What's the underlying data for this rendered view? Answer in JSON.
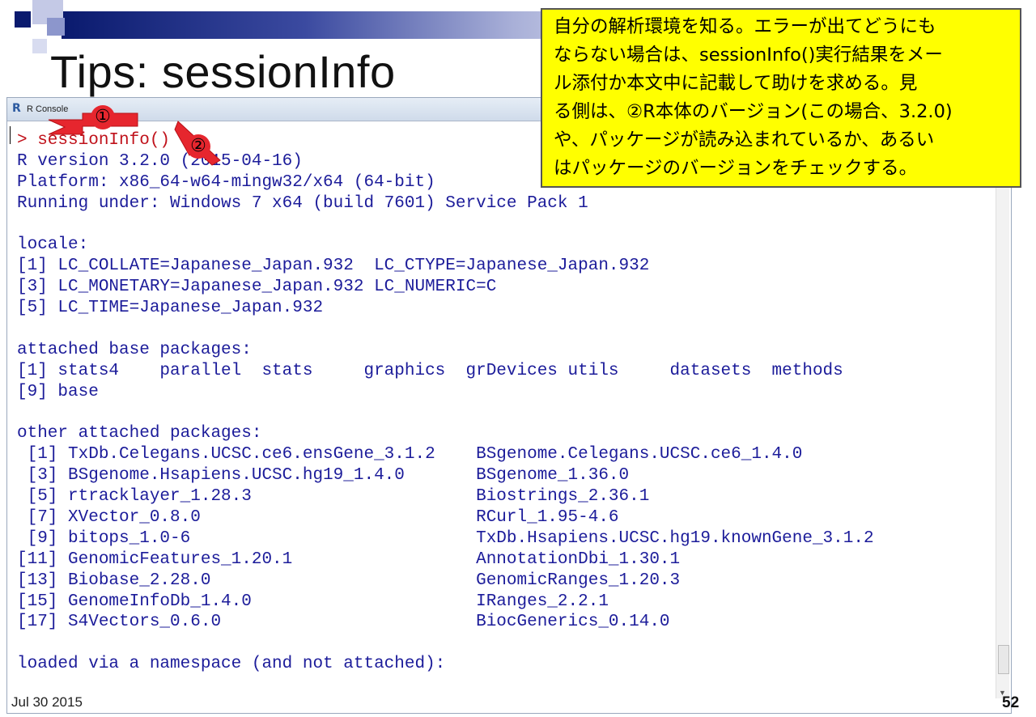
{
  "slide": {
    "title": "Tips: sessionInfo",
    "footer_date": "Jul 30 2015",
    "page_number": "52"
  },
  "console": {
    "window_title": "R Console",
    "lines": [
      "> sessionInfo()",
      "R version 3.2.0 (2015-04-16)",
      "Platform: x86_64-w64-mingw32/x64 (64-bit)",
      "Running under: Windows 7 x64 (build 7601) Service Pack 1",
      "",
      "locale:",
      "[1] LC_COLLATE=Japanese_Japan.932  LC_CTYPE=Japanese_Japan.932",
      "[3] LC_MONETARY=Japanese_Japan.932 LC_NUMERIC=C",
      "[5] LC_TIME=Japanese_Japan.932",
      "",
      "attached base packages:",
      "[1] stats4    parallel  stats     graphics  grDevices utils     datasets  methods",
      "[9] base",
      "",
      "other attached packages:",
      " [1] TxDb.Celegans.UCSC.ce6.ensGene_3.1.2    BSgenome.Celegans.UCSC.ce6_1.4.0",
      " [3] BSgenome.Hsapiens.UCSC.hg19_1.4.0       BSgenome_1.36.0",
      " [5] rtracklayer_1.28.3                      Biostrings_2.36.1",
      " [7] XVector_0.8.0                           RCurl_1.95-4.6",
      " [9] bitops_1.0-6                            TxDb.Hsapiens.UCSC.hg19.knownGene_3.1.2",
      "[11] GenomicFeatures_1.20.1                  AnnotationDbi_1.30.1",
      "[13] Biobase_2.28.0                          GenomicRanges_1.20.3",
      "[15] GenomeInfoDb_1.4.0                      IRanges_2.2.1",
      "[17] S4Vectors_0.6.0                         BiocGenerics_0.14.0",
      "",
      "loaded via a namespace (and not attached):"
    ]
  },
  "callout": {
    "lines": [
      "自分の解析環境を知る。エラーが出てどうにも",
      "ならない場合は、sessionInfo()実行結果をメー",
      "ル添付か本文中に記載して助けを求める。見",
      "る側は、②R本体のバージョン(この場合、3.2.0)",
      "や、パッケージが読み込まれているか、あるい",
      "はパッケージのバージョンをチェックする。"
    ]
  },
  "markers": {
    "one": "①",
    "two": "②"
  },
  "colors": {
    "command_text": "#c0121b",
    "output_text": "#1c1c9a",
    "callout_bg": "#ffff00",
    "marker": "#e6262e"
  }
}
